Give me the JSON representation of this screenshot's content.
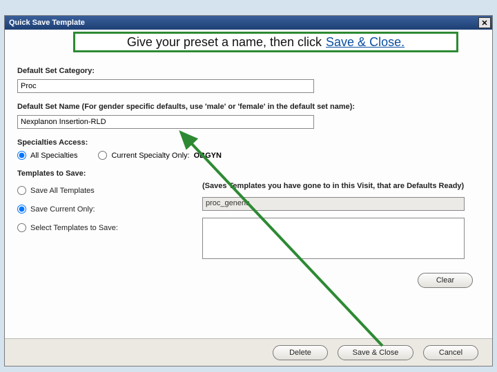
{
  "window": {
    "title": "Quick Save Template"
  },
  "annotation": {
    "text_plain": "Give your preset a name, then click ",
    "link_text": "Save & Close."
  },
  "category": {
    "label": "Default Set Category:",
    "value": "Proc"
  },
  "setname": {
    "label": "Default Set Name (For gender specific defaults, use 'male' or 'female' in the default set name):",
    "value": "Nexplanon Insertion-RLD"
  },
  "specialties": {
    "label": "Specialties Access:",
    "opt_all": "All Specialties",
    "opt_current_label": "Current Specialty Only:",
    "opt_current_value": "OBGYN"
  },
  "templates": {
    "label": "Templates to Save:",
    "opt_all": "Save All Templates",
    "opt_current": "Save Current Only:",
    "opt_select": "Select Templates to Save:",
    "hint": "(Saves Templates you have gone to in this Visit, that are Defaults Ready)",
    "current_value": "proc_generic"
  },
  "buttons": {
    "clear": "Clear",
    "delete": "Delete",
    "save_close": "Save & Close",
    "cancel": "Cancel"
  }
}
